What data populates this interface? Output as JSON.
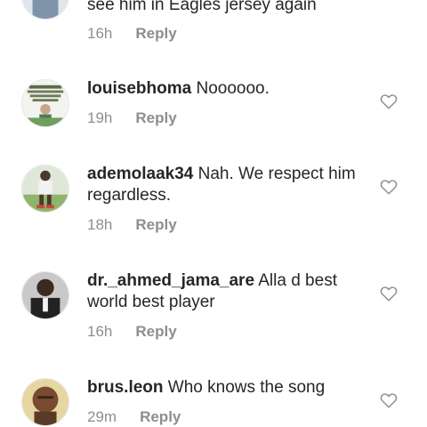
{
  "comments": [
    {
      "username": "",
      "text": "see him in Eagles jersey again",
      "time": "16h",
      "reply_label": "Reply"
    },
    {
      "username": "louisebhoma",
      "text": "Noooooo.",
      "time": "19h",
      "reply_label": "Reply",
      "like_icon": "heart-outline-icon"
    },
    {
      "username": "ademolaak34",
      "text": "Nah. We respect him regardless.",
      "time": "18h",
      "reply_label": "Reply",
      "like_icon": "heart-outline-icon"
    },
    {
      "username": "dr._ahmed_jama_are",
      "text": "Alla d best world best player",
      "time": "16h",
      "reply_label": "Reply",
      "like_icon": "heart-outline-icon"
    },
    {
      "username": "brus.leon",
      "text": "Who knows the song",
      "time": "29m",
      "reply_label": "Reply",
      "like_icon": "heart-outline-icon"
    }
  ]
}
